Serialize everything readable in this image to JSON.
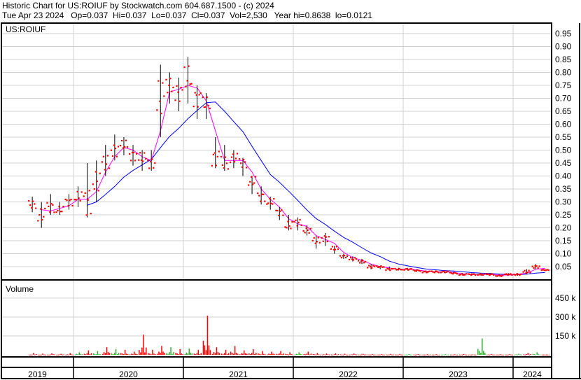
{
  "header": {
    "line1": "Historic Chart for US:ROIUF by Stockwatch.com 604.687.1500 - (c) 2024",
    "line2": "Tue Apr 23 2024   Op=0.037  Hi=0.037  Lo=0.037  Cl=0.037  Vol=2,530   Year hi=0.8638  lo=0.0121"
  },
  "chart_data": {
    "type": "line",
    "symbol": "US:ROIUF",
    "volume_label": "Volume",
    "price_ticks": [
      "0.95",
      "0.90",
      "0.85",
      "0.80",
      "0.75",
      "0.70",
      "0.65",
      "0.60",
      "0.55",
      "0.50",
      "0.45",
      "0.40",
      "0.35",
      "0.30",
      "0.25",
      "0.20",
      "0.15",
      "0.10",
      "0.05"
    ],
    "price_tick_values": [
      0.95,
      0.9,
      0.85,
      0.8,
      0.75,
      0.7,
      0.65,
      0.6,
      0.55,
      0.5,
      0.45,
      0.4,
      0.35,
      0.3,
      0.25,
      0.2,
      0.15,
      0.1,
      0.05
    ],
    "volume_ticks": [
      "450 k",
      "300 k",
      "150 k"
    ],
    "volume_tick_values": [
      450000,
      300000,
      150000
    ],
    "year_labels": [
      "2019",
      "2020",
      "2021",
      "2022",
      "2023",
      "2024"
    ],
    "colors": {
      "price": "#ff0000",
      "short_ma": "#ff00ff",
      "long_ma": "#0000ff",
      "vol_up": "#33aa33",
      "vol_down": "#ff0000"
    },
    "short_ma_period": 2,
    "long_ma_period": 7,
    "start": "2019-08",
    "close": [
      0.29,
      0.25,
      0.28,
      0.27,
      0.3,
      0.32,
      0.3,
      0.38,
      0.45,
      0.5,
      0.52,
      0.48,
      0.47,
      0.45,
      0.7,
      0.75,
      0.72,
      0.78,
      0.7,
      0.68,
      0.47,
      0.45,
      0.47,
      0.45,
      0.38,
      0.32,
      0.3,
      0.26,
      0.21,
      0.22,
      0.19,
      0.15,
      0.16,
      0.12,
      0.09,
      0.08,
      0.07,
      0.05,
      0.05,
      0.04,
      0.04,
      0.04,
      0.035,
      0.03,
      0.03,
      0.03,
      0.025,
      0.02,
      0.02,
      0.02,
      0.02,
      0.015,
      0.02,
      0.02,
      0.03,
      0.05,
      0.037
    ],
    "high": [
      0.32,
      0.3,
      0.33,
      0.3,
      0.33,
      0.36,
      0.45,
      0.46,
      0.52,
      0.56,
      0.55,
      0.52,
      0.5,
      0.5,
      0.83,
      0.8,
      0.78,
      0.86,
      0.75,
      0.72,
      0.55,
      0.52,
      0.5,
      0.47,
      0.4,
      0.36,
      0.32,
      0.28,
      0.25,
      0.24,
      0.21,
      0.17,
      0.18,
      0.13,
      0.1,
      0.09,
      0.08,
      0.06,
      0.05,
      0.05,
      0.045,
      0.045,
      0.04,
      0.035,
      0.035,
      0.035,
      0.03,
      0.025,
      0.025,
      0.025,
      0.025,
      0.02,
      0.025,
      0.025,
      0.04,
      0.06,
      0.04
    ],
    "low": [
      0.26,
      0.2,
      0.25,
      0.25,
      0.27,
      0.28,
      0.24,
      0.3,
      0.4,
      0.46,
      0.48,
      0.44,
      0.42,
      0.42,
      0.55,
      0.68,
      0.65,
      0.68,
      0.62,
      0.62,
      0.43,
      0.42,
      0.43,
      0.4,
      0.33,
      0.29,
      0.27,
      0.23,
      0.19,
      0.19,
      0.17,
      0.12,
      0.13,
      0.1,
      0.08,
      0.07,
      0.06,
      0.04,
      0.04,
      0.035,
      0.035,
      0.035,
      0.03,
      0.025,
      0.025,
      0.025,
      0.02,
      0.015,
      0.015,
      0.015,
      0.015,
      0.012,
      0.015,
      0.015,
      0.02,
      0.04,
      0.035
    ],
    "volume": [
      15000,
      10000,
      12000,
      8000,
      14000,
      20000,
      35000,
      30000,
      60000,
      45000,
      40000,
      25000,
      160000,
      40000,
      70000,
      60000,
      45000,
      50000,
      40000,
      310000,
      60000,
      40000,
      70000,
      35000,
      45000,
      30000,
      25000,
      30000,
      20000,
      20000,
      25000,
      15000,
      10000,
      12000,
      8000,
      10000,
      8000,
      6000,
      5000,
      7000,
      5000,
      6000,
      5000,
      4000,
      4000,
      5000,
      4000,
      5000,
      3000,
      130000,
      6000,
      4000,
      5000,
      8000,
      15000,
      20000,
      2530
    ]
  }
}
